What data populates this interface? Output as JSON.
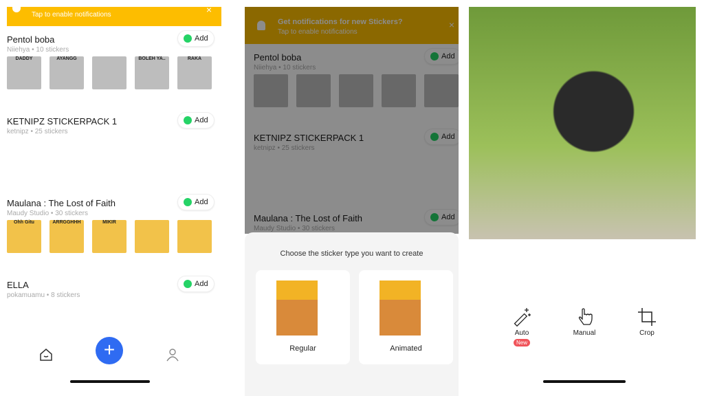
{
  "panel1": {
    "banner": {
      "text": "Tap to enable notifications",
      "close": "×"
    },
    "packs": [
      {
        "title": "Pentol boba",
        "sub": "Niiehya • 10 stickers",
        "add": "Add",
        "style": "gray",
        "stickers": [
          "DADDY",
          "AYANGG",
          "",
          "BOLEH YA..",
          "RAKA"
        ]
      },
      {
        "title": "KETNIPZ STICKERPACK 1",
        "sub": "ketnipz • 25 stickers",
        "add": "Add",
        "style": "face",
        "stickers": [
          "",
          "",
          "",
          "",
          ""
        ]
      },
      {
        "title": "Maulana : The Lost of Faith",
        "sub": "Maudy Studio • 30 stickers",
        "add": "Add",
        "style": "photo",
        "stickers": [
          "Ohh Gitu",
          "ARRGGHHH",
          "MIKIR",
          "",
          ""
        ]
      },
      {
        "title": "ELLA",
        "sub": "pokamuamu • 8 stickers",
        "add": "Add",
        "style": "face",
        "stickers": [
          "",
          "",
          "",
          "",
          ""
        ]
      }
    ],
    "nav": {
      "home": "home-icon",
      "add": "+",
      "profile": "user-icon"
    }
  },
  "panel2": {
    "banner": {
      "title": "Get notifications for new Stickers?",
      "text": "Tap to enable notifications"
    },
    "packs": [
      {
        "title": "Pentol boba",
        "sub": "Niiehya • 10 stickers",
        "add": "Add"
      },
      {
        "title": "KETNIPZ STICKERPACK 1",
        "sub": "ketnipz • 25 stickers",
        "add": "Add"
      },
      {
        "title": "Maulana : The Lost of Faith",
        "sub": "Maudy Studio • 30 stickers",
        "add": "Add"
      }
    ],
    "sheet": {
      "prompt": "Choose the sticker type you want to create",
      "options": [
        {
          "label": "Regular"
        },
        {
          "label": "Animated"
        }
      ]
    }
  },
  "panel3": {
    "tools": [
      {
        "label": "Auto",
        "badge": "New"
      },
      {
        "label": "Manual"
      },
      {
        "label": "Crop"
      }
    ],
    "colors": {
      "badge": "#f0545a",
      "accent": "#2f6bf2",
      "banner": "#fdbd00"
    }
  }
}
